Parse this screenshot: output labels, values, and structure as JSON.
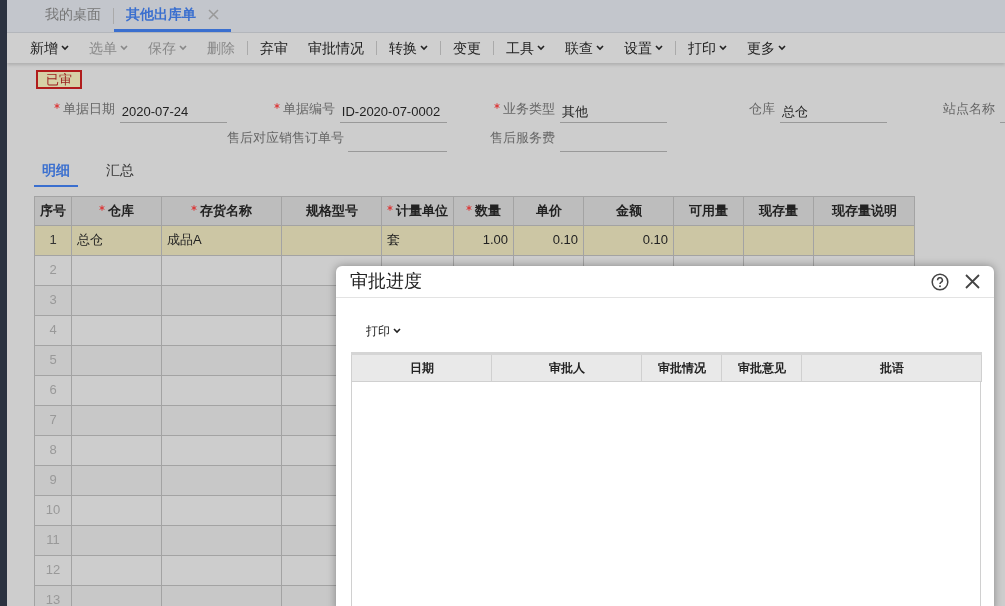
{
  "app_tabs": [
    {
      "label": "我的桌面",
      "selected": false,
      "closable": false
    },
    {
      "label": "其他出库单",
      "selected": true,
      "closable": true
    }
  ],
  "toolbar": [
    {
      "label": "新增",
      "dropdown": true,
      "disabled": false,
      "separator_before": false
    },
    {
      "label": "选单",
      "dropdown": true,
      "disabled": true,
      "separator_before": false
    },
    {
      "label": "保存",
      "dropdown": true,
      "disabled": true,
      "separator_before": false
    },
    {
      "label": "删除",
      "dropdown": false,
      "disabled": true,
      "separator_before": false
    },
    {
      "label": "弃审",
      "dropdown": false,
      "disabled": false,
      "separator_before": true
    },
    {
      "label": "审批情况",
      "dropdown": false,
      "disabled": false,
      "separator_before": false
    },
    {
      "label": "转换",
      "dropdown": true,
      "disabled": false,
      "separator_before": true
    },
    {
      "label": "变更",
      "dropdown": false,
      "disabled": false,
      "separator_before": true
    },
    {
      "label": "工具",
      "dropdown": true,
      "disabled": false,
      "separator_before": true
    },
    {
      "label": "联查",
      "dropdown": true,
      "disabled": false,
      "separator_before": false
    },
    {
      "label": "设置",
      "dropdown": true,
      "disabled": false,
      "separator_before": false
    },
    {
      "label": "打印",
      "dropdown": true,
      "disabled": false,
      "separator_before": true
    },
    {
      "label": "更多",
      "dropdown": true,
      "disabled": false,
      "separator_before": false
    }
  ],
  "status_stamp": "已审",
  "form": {
    "rows": [
      [
        {
          "label": "单据日期",
          "required": true,
          "value": "2020-07-24"
        },
        {
          "label": "单据编号",
          "required": true,
          "value": "ID-2020-07-0002"
        },
        {
          "label": "业务类型",
          "required": true,
          "value": "其他"
        },
        {
          "label": "仓库",
          "required": false,
          "value": "总仓"
        },
        {
          "label": "站点名称",
          "required": false
        }
      ],
      [
        null,
        {
          "label": "售后对应销售订单号",
          "required": false
        },
        {
          "label": "售后服务费",
          "required": false
        }
      ]
    ]
  },
  "detail_tabs": [
    {
      "label": "明细",
      "selected": true
    },
    {
      "label": "汇总",
      "selected": false
    }
  ],
  "table": {
    "columns": [
      {
        "label": "序号",
        "required": false
      },
      {
        "label": "仓库",
        "required": true
      },
      {
        "label": "存货名称",
        "required": true
      },
      {
        "label": "规格型号",
        "required": false
      },
      {
        "label": "计量单位",
        "required": true
      },
      {
        "label": "数量",
        "required": true
      },
      {
        "label": "单价",
        "required": false
      },
      {
        "label": "金额",
        "required": false
      },
      {
        "label": "可用量",
        "required": false
      },
      {
        "label": "现存量",
        "required": false
      },
      {
        "label": "现存量说明",
        "required": false
      }
    ],
    "rows": [
      {
        "number": "1",
        "selected": true,
        "cells": [
          "总仓",
          "成品A",
          null,
          "套",
          "1.00",
          "0.10",
          "0.10",
          null,
          null,
          null
        ]
      },
      {
        "number": "2",
        "selected": false
      },
      {
        "number": "3",
        "selected": false
      },
      {
        "number": "4",
        "selected": false
      },
      {
        "number": "5",
        "selected": false
      },
      {
        "number": "6",
        "selected": false
      },
      {
        "number": "7",
        "selected": false
      },
      {
        "number": "8",
        "selected": false
      },
      {
        "number": "9",
        "selected": false
      },
      {
        "number": "10",
        "selected": false
      },
      {
        "number": "11",
        "selected": false
      },
      {
        "number": "12",
        "selected": false
      },
      {
        "number": "13",
        "selected": false
      }
    ]
  },
  "dialog": {
    "title": "审批进度",
    "toolbar": [
      {
        "label": "打印",
        "dropdown": true
      }
    ],
    "columns": [
      "日期",
      "审批人",
      "审批情况",
      "审批意见",
      "批语"
    ]
  }
}
